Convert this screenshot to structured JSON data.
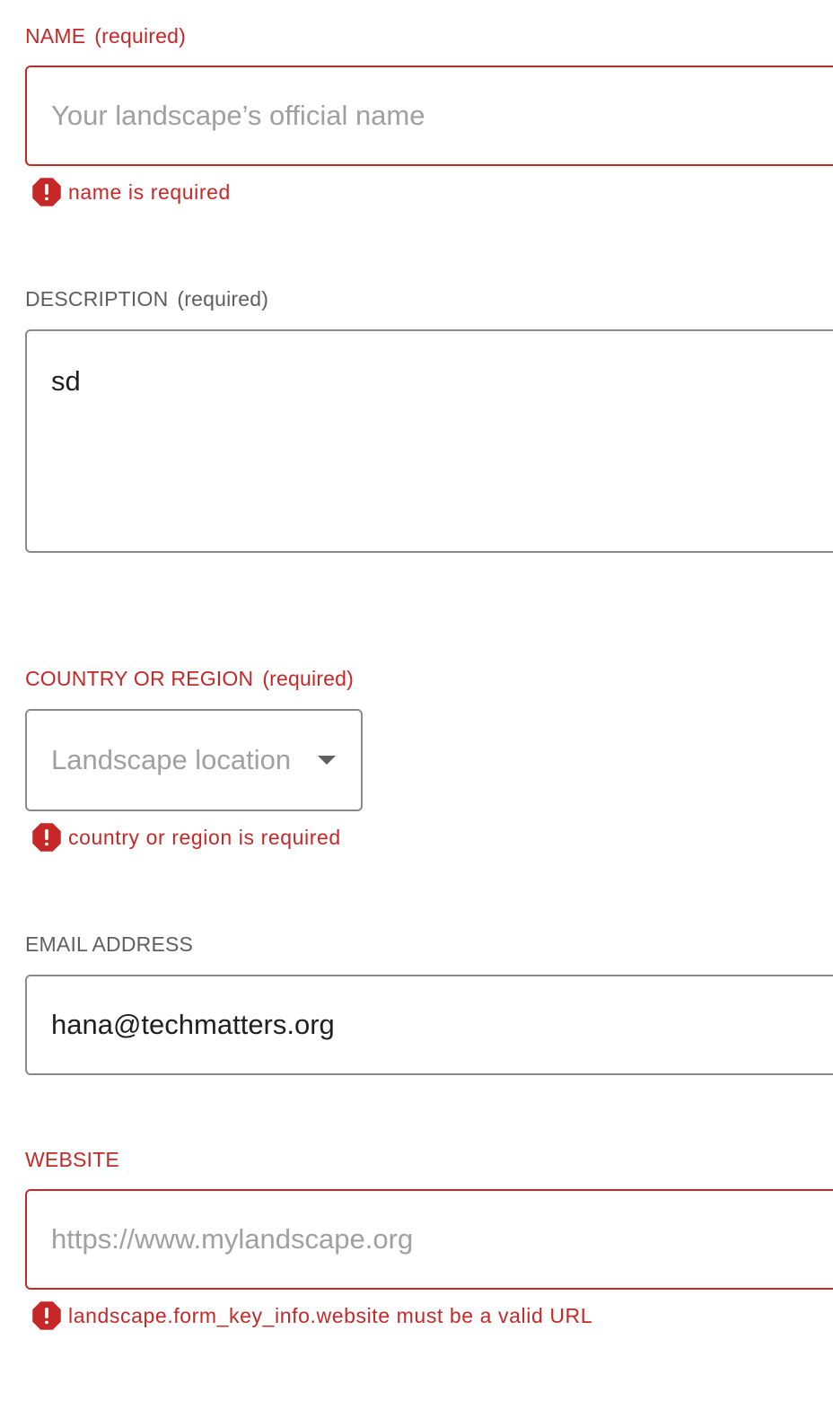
{
  "form": {
    "name": {
      "label": "NAME",
      "required_marker": "(required)",
      "value": "",
      "placeholder": "Your landscape’s official name",
      "error": "name is required"
    },
    "description": {
      "label": "DESCRIPTION",
      "required_marker": "(required)",
      "value": "sd"
    },
    "country": {
      "label": "COUNTRY OR REGION",
      "required_marker": "(required)",
      "placeholder": "Landscape location",
      "error": "country or region is required"
    },
    "email": {
      "label": "EMAIL ADDRESS",
      "value": "hana@techmatters.org"
    },
    "website": {
      "label": "WEBSITE",
      "value": "",
      "placeholder": "https://www.mylandscape.org",
      "error": "landscape.form_key_info.website must be a valid URL"
    }
  },
  "icons": {
    "error": "error-octagon-icon",
    "dropdown": "caret-down-icon"
  },
  "colors": {
    "error": "#c62828",
    "label": "#5f5f5f",
    "border": "#8a8a8a",
    "placeholder": "#a0a0a0",
    "text": "#1f1f1f"
  }
}
